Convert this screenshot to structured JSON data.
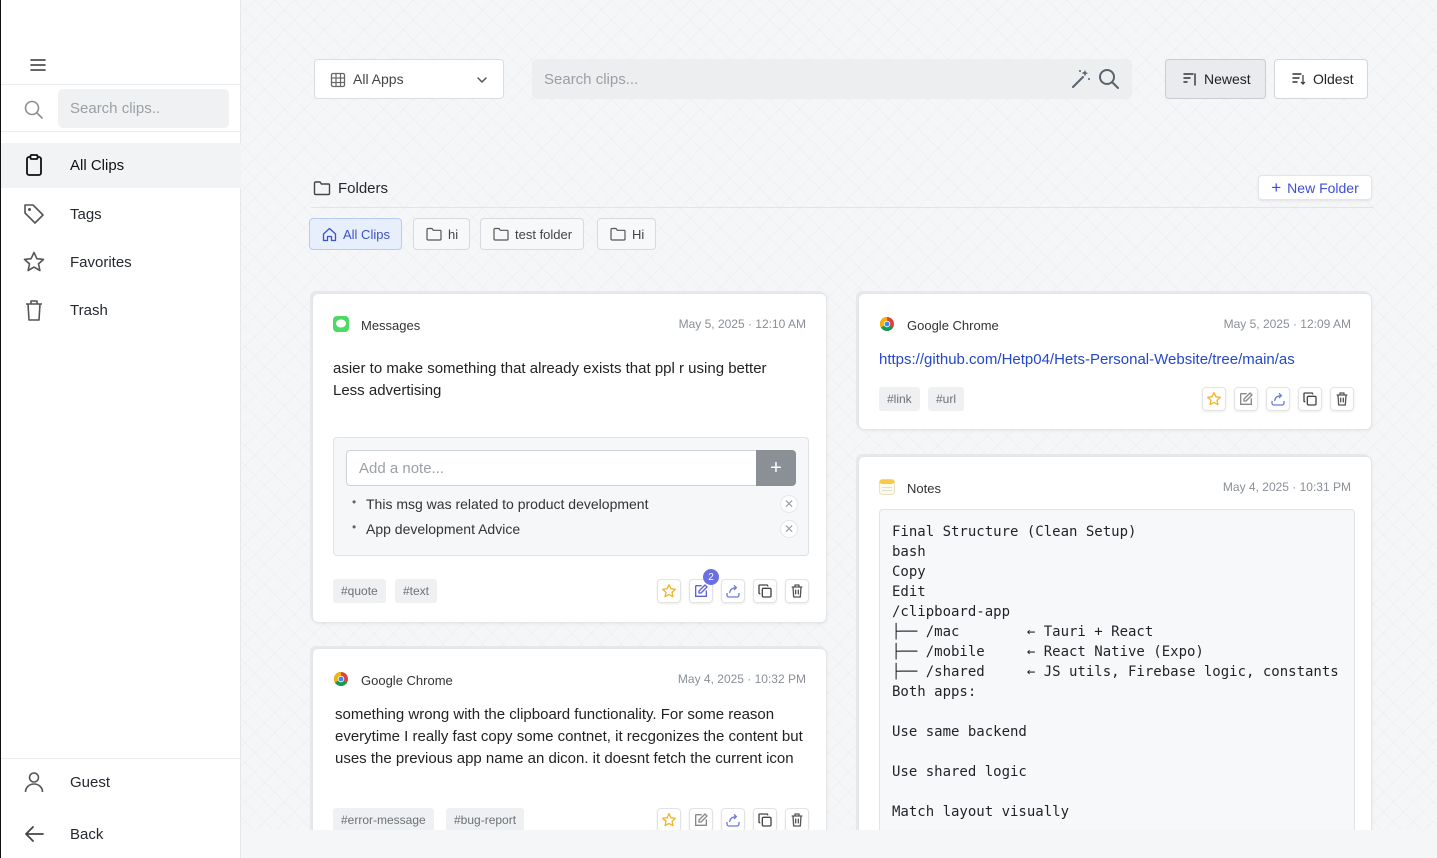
{
  "sidebar": {
    "search_placeholder": "Search clips..",
    "nav": [
      {
        "label": "All Clips",
        "icon": "clipboard-icon"
      },
      {
        "label": "Tags",
        "icon": "tag-icon"
      },
      {
        "label": "Favorites",
        "icon": "star-icon"
      },
      {
        "label": "Trash",
        "icon": "trash-icon"
      }
    ],
    "bottom": [
      {
        "label": "Guest",
        "icon": "user-icon"
      },
      {
        "label": "Back",
        "icon": "arrow-left-icon"
      }
    ]
  },
  "toolbar": {
    "app_filter": "All Apps",
    "search_placeholder": "Search clips...",
    "sort_newest": "Newest",
    "sort_oldest": "Oldest"
  },
  "folders": {
    "title": "Folders",
    "new_folder": "New Folder",
    "chips": [
      "All Clips",
      "hi",
      "test folder",
      "Hi"
    ]
  },
  "clips": [
    {
      "app": "Messages",
      "time": "May 5, 2025 · 12:10 AM",
      "lines": [
        "asier to make something that already exists that ppl r using better",
        "Less advertising"
      ],
      "note_placeholder": "Add a note...",
      "note_add": "+",
      "notes": [
        "This msg was related to product development",
        "App development Advice"
      ],
      "note_count": "2",
      "tags": [
        "#quote",
        "#text"
      ]
    },
    {
      "app": "Google Chrome",
      "time": "May 5, 2025 · 12:09 AM",
      "link": "https://github.com/Hetp04/Hets-Personal-Website/tree/main/as",
      "tags": [
        "#link",
        "#url"
      ]
    },
    {
      "app": "Notes",
      "time": "May 4, 2025 · 10:31 PM",
      "code": "Final Structure (Clean Setup)\nbash\nCopy\nEdit\n/clipboard-app\n├── /mac        ← Tauri + React\n├── /mobile     ← React Native (Expo)\n├── /shared     ← JS utils, Firebase logic, constants\nBoth apps:\n\nUse same backend\n\nUse shared logic\n\nMatch layout visually"
    },
    {
      "app": "Google Chrome",
      "time": "May 4, 2025 · 10:32 PM",
      "text": "something wrong with the clipboard functionality. For some reason everytime I really fast copy some contnet, it recgonizes the content but uses the previous app name an dicon. it doesnt fetch the current icon",
      "tags": [
        "#error-message",
        "#bug-report"
      ]
    }
  ],
  "colors": {
    "accent": "#3d4ed8",
    "link": "#2548c9",
    "favorite_star": "#f0b429",
    "badge": "#6a6fe2"
  }
}
